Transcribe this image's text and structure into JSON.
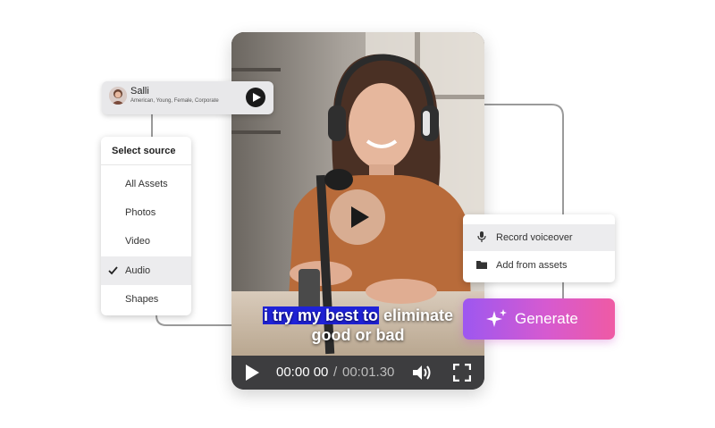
{
  "voice": {
    "name": "Salli",
    "description": "American, Young, Female, Corporate",
    "play_icon": "play-icon"
  },
  "source_menu": {
    "title": "Select source",
    "items": [
      {
        "label": "All Assets",
        "selected": false
      },
      {
        "label": "Photos",
        "selected": false
      },
      {
        "label": "Video",
        "selected": false
      },
      {
        "label": "Audio",
        "selected": true
      },
      {
        "label": "Shapes",
        "selected": false
      }
    ]
  },
  "video": {
    "subtitle_highlight": "i try my best to",
    "subtitle_rest_line1": "eliminate",
    "subtitle_line2": "good or bad",
    "time_current": "00:00 00",
    "time_separator": "/",
    "time_total": "00:01.30",
    "subtitle_highlight_color": "#1f22d9"
  },
  "record_menu": {
    "items": [
      {
        "label": "Record voiceover",
        "icon": "microphone-icon",
        "active": true
      },
      {
        "label": "Add from assets",
        "icon": "folder-icon",
        "active": false
      }
    ]
  },
  "generate": {
    "label": "Generate",
    "icon": "sparkle-icon",
    "gradient": [
      "#9d57f0",
      "#ef5aa4"
    ]
  }
}
